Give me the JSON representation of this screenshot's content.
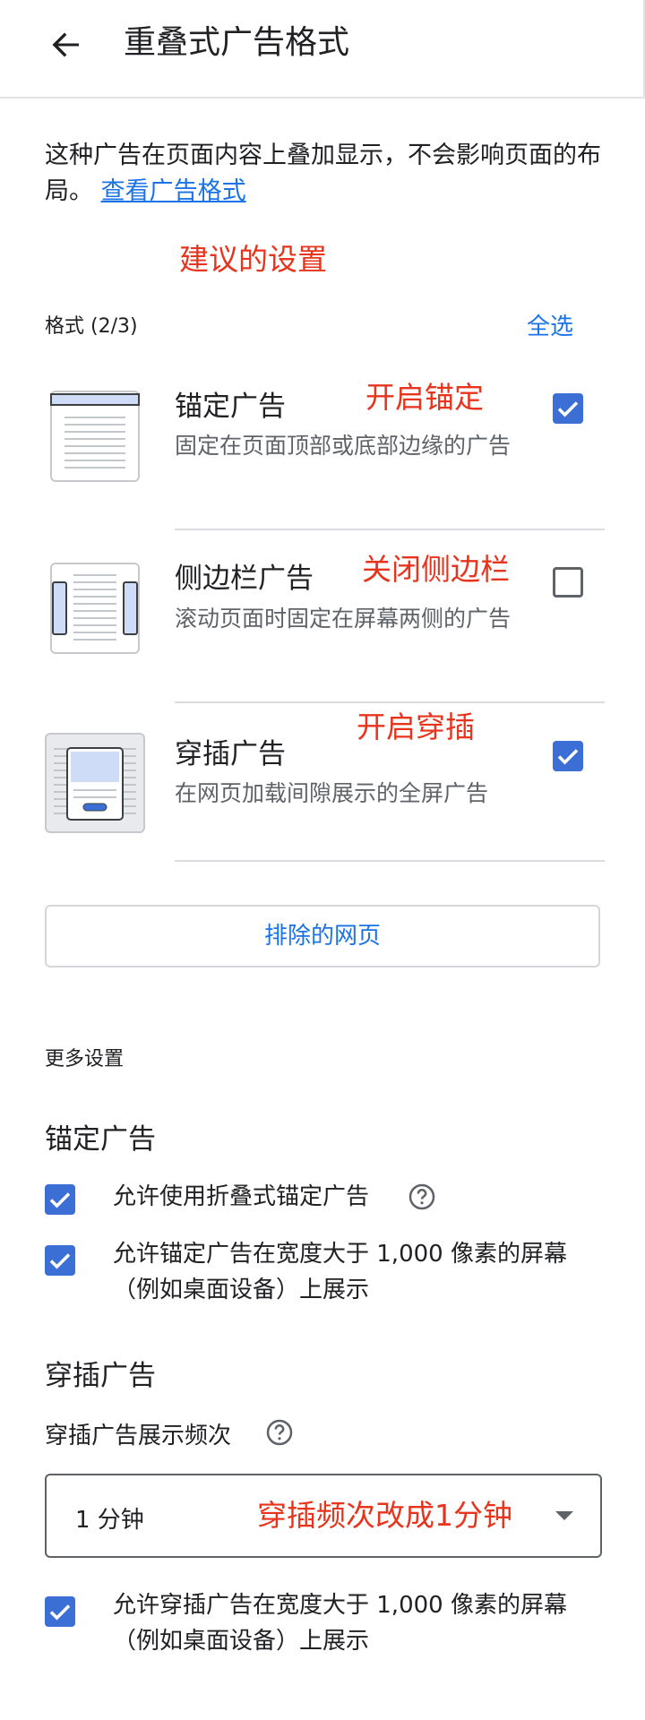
{
  "header": {
    "title": "重叠式广告格式",
    "back_icon": "back-arrow-icon"
  },
  "intro": {
    "text": "这种广告在页面内容上叠加显示，不会影响页面的布局。",
    "link": "查看广告格式"
  },
  "annotations": {
    "recommended": "建议的设置",
    "anchor_on": "开启锚定",
    "side_off": "关闭侧边栏",
    "interstitial_on": "开启穿插",
    "freq_change": "穿插频次改成1分钟"
  },
  "formats": {
    "label": "格式 (2/3)",
    "select_all": "全选",
    "items": [
      {
        "title": "锚定广告",
        "desc": "固定在页面顶部或底部边缘的广告",
        "checked": true,
        "icon": "anchor-ad-icon"
      },
      {
        "title": "侧边栏广告",
        "desc": "滚动页面时固定在屏幕两侧的广告",
        "checked": false,
        "icon": "side-rail-ad-icon"
      },
      {
        "title": "穿插广告",
        "desc": "在网页加载间隙展示的全屏广告",
        "checked": true,
        "icon": "interstitial-ad-icon"
      }
    ]
  },
  "excluded_button": "排除的网页",
  "more_settings": {
    "label": "更多设置",
    "anchor": {
      "title": "锚定广告",
      "options": [
        {
          "label": "允许使用折叠式锚定广告",
          "checked": true,
          "help_icon": "help-circle-icon"
        },
        {
          "label": "允许锚定广告在宽度大于 1,000 像素的屏幕（例如桌面设备）上展示",
          "checked": true
        }
      ]
    },
    "interstitial": {
      "title": "穿插广告",
      "freq_label": "穿插广告展示频次",
      "help_icon": "help-circle-icon",
      "freq_value": "1 分钟",
      "dropdown_icon": "dropdown-arrow-icon",
      "options": [
        {
          "label": "允许穿插广告在宽度大于 1,000 像素的屏幕（例如桌面设备）上展示",
          "checked": true
        }
      ]
    }
  },
  "colors": {
    "accent": "#1a73e8",
    "checkbox": "#3b6fd6",
    "annotation": "#e8341c"
  }
}
